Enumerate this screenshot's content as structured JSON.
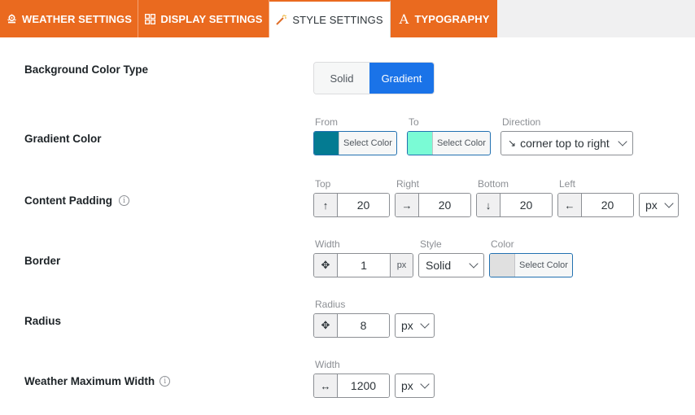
{
  "tabs": [
    {
      "label": "Weather Settings",
      "icon": "weather-cloud-icon",
      "active": false
    },
    {
      "label": "Display Settings",
      "icon": "grid-icon",
      "active": false
    },
    {
      "label": "Style Settings",
      "icon": "magic-wand-icon",
      "active": true
    },
    {
      "label": "Typography",
      "icon": "typography-icon",
      "active": false
    }
  ],
  "colors": {
    "accent_orange": "#ea6a1f",
    "primary_blue": "#1a73e8",
    "gradient_from": "#047b92",
    "gradient_to": "#7afbd5",
    "border_color": "#e0e0e0"
  },
  "background_color_type": {
    "label": "Background Color Type",
    "options": [
      "Solid",
      "Gradient"
    ],
    "selected": "Gradient"
  },
  "gradient_color": {
    "label": "Gradient Color",
    "from_label": "From",
    "to_label": "To",
    "direction_label": "Direction",
    "select_color_text": "Select Color",
    "direction_icon": "↘",
    "direction_value": "corner top to right"
  },
  "content_padding": {
    "label": "Content Padding",
    "fields": [
      {
        "label": "Top",
        "icon": "↑",
        "value": "20"
      },
      {
        "label": "Right",
        "icon": "→",
        "value": "20"
      },
      {
        "label": "Bottom",
        "icon": "↓",
        "value": "20"
      },
      {
        "label": "Left",
        "icon": "←",
        "value": "20"
      }
    ],
    "unit": "px"
  },
  "border": {
    "label": "Border",
    "width_label": "Width",
    "width_value": "1",
    "width_unit": "px",
    "style_label": "Style",
    "style_value": "Solid",
    "color_label": "Color",
    "select_color_text": "Select Color"
  },
  "radius": {
    "label": "Radius",
    "field_label": "Radius",
    "value": "8",
    "unit": "px"
  },
  "max_width": {
    "label": "Weather Maximum Width",
    "field_label": "Width",
    "value": "1200",
    "unit": "px"
  },
  "info_icon_glyph": "i",
  "move_icon_glyph": "✥",
  "horizontal_arrows_glyph": "↔"
}
